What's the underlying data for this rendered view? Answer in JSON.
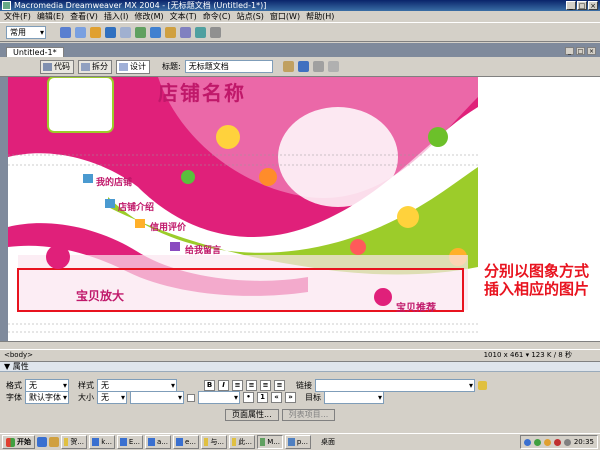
{
  "window": {
    "title": "Macromedia Dreamweaver MX 2004 - [无标题文档 (Untitled-1*)]",
    "controls": [
      "_",
      "□",
      "×"
    ]
  },
  "menu": [
    "文件(F)",
    "编辑(E)",
    "查看(V)",
    "插入(I)",
    "修改(M)",
    "文本(T)",
    "命令(C)",
    "站点(S)",
    "窗口(W)",
    "帮助(H)"
  ],
  "insert_bar": {
    "category": "常用"
  },
  "document": {
    "tab": "Untitled-1*",
    "views": [
      "代码",
      "拆分",
      "设计"
    ],
    "active_view": "设计",
    "title_label": "标题:",
    "title_value": "无标题文档"
  },
  "canvas": {
    "shop_name": "店铺名称",
    "nav": [
      "我的店铺",
      "店铺介绍",
      "信用评价",
      "给我留言"
    ],
    "section_left": "宝贝放大",
    "section_right": "宝贝推荐"
  },
  "annotation": "分别以图象方式插入相应的图片",
  "status": {
    "tag": "<body>",
    "info": "1010 x 461 ▾ 123 K / 8 秒"
  },
  "properties": {
    "header": "属性",
    "format_label": "格式",
    "format_value": "无",
    "style_label": "样式",
    "style_value": "无",
    "bold": "B",
    "italic": "I",
    "link_label": "链接",
    "font_label": "字体",
    "font_value": "默认字体",
    "size_label": "大小",
    "size_value": "无",
    "target_label": "目标",
    "page_props_button": "页面属性...",
    "list_item_button": "列表项目..."
  },
  "taskbar": {
    "start": "开始",
    "tasks": [
      "贺...",
      "k...",
      "E...",
      "a...",
      "e...",
      "与...",
      "此...",
      "M...",
      "p..."
    ],
    "desktop_label": "桌面",
    "clock": "20:35"
  },
  "colors": {
    "title_bar": "#0a246a",
    "banner_pink": "#e0207a",
    "banner_green": "#9ccc2a",
    "annotation_red": "#e8131f"
  }
}
